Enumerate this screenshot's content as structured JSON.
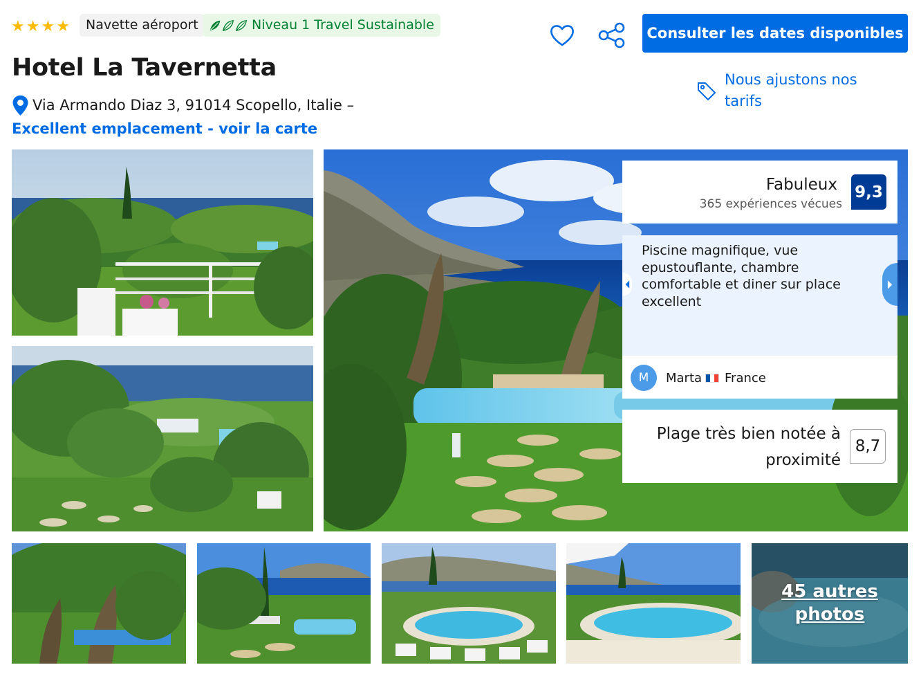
{
  "header": {
    "star_rating": 4,
    "stars": [
      "★",
      "★",
      "★",
      "★"
    ],
    "shuttle_badge": "Navette aéroport",
    "sustainable_badge": "Niveau 1 Travel Sustainable",
    "cta_label": "Consulter les dates disponibles",
    "price_match_label": "Nous ajustons nos tarifs"
  },
  "hotel": {
    "name": "Hotel La Tavernetta",
    "address": "Via Armando Diaz 3, 91014 Scopello, Italie –",
    "map_link": "Excellent emplacement - voir la carte"
  },
  "score": {
    "label": "Fabuleux",
    "reviews_count": "365 expériences vécues",
    "value": "9,3"
  },
  "review": {
    "text": "Piscine magnifique, vue epustouflante, chambre comfortable et diner sur place excellent",
    "avatar_initial": "M",
    "reviewer": "Marta",
    "country": "France"
  },
  "beach": {
    "label": "Plage très bien notée à proximité",
    "score": "8,7"
  },
  "gallery": {
    "more_photos_label": "45 autres photos"
  },
  "colors": {
    "brand_blue": "#006ce4",
    "score_navy": "#003b95",
    "star_yellow": "#febb02",
    "sustainable_green": "#008234"
  },
  "icons": {
    "save": "heart-icon",
    "share": "share-icon",
    "location": "map-pin-icon",
    "price_tag": "price-tag-icon",
    "sustainable": "leaf-icon"
  }
}
